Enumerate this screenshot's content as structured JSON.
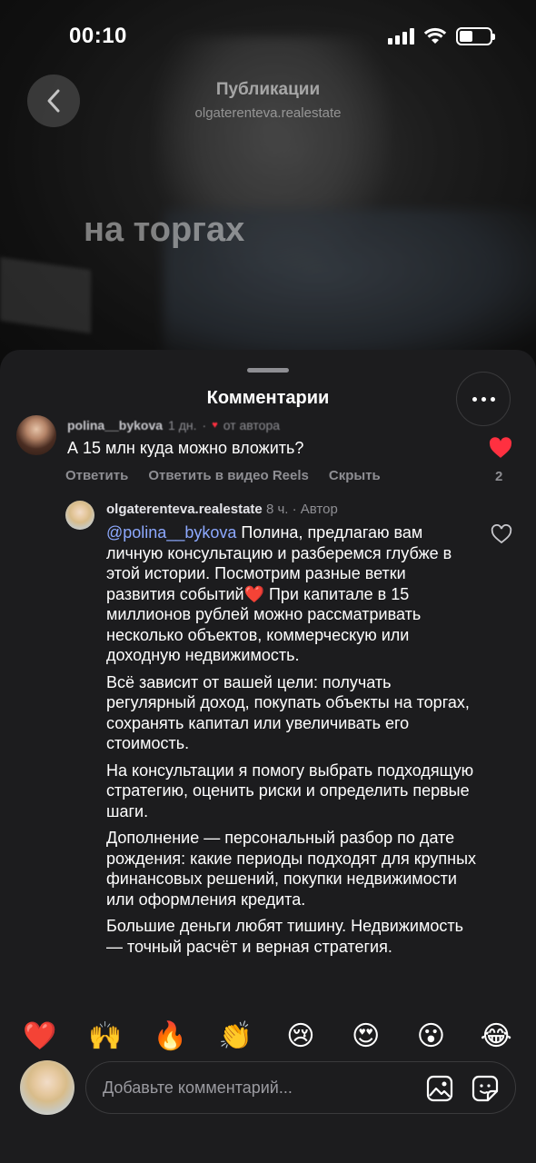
{
  "status_bar": {
    "time": "00:10"
  },
  "header": {
    "title": "Публикации",
    "subtitle": "olgaterenteva.realestate"
  },
  "video_overlay_text": "на торгах",
  "sheet": {
    "title": "Комментарии"
  },
  "comment1": {
    "username": "polina__bykova",
    "age": "1 дн.",
    "liked_by_author": "от автора",
    "text": "А 15 млн куда можно вложить?",
    "reply_label": "Ответить",
    "reply_video_label": "Ответить в видео Reels",
    "hide_label": "Скрыть",
    "likes": "2"
  },
  "comment2": {
    "username": "olgaterenteva.realestate",
    "meta": "8 ч. · Автор",
    "mention": "@polina__bykova",
    "p1": " Полина, предлагаю вам личную консультацию и разберемся глубже в этой истории. Посмотрим разные ветки развития событий",
    "p1_emoji": "❤️",
    "p1_tail": " При капитале в 15 миллионов рублей можно рассматривать несколько объектов, коммерческую или доходную недвижимость.",
    "p2": "Всё зависит от вашей цели: получать регулярный доход, покупать объекты на торгах, сохранять капитал или увеличивать его стоимость.",
    "p3": "На консультации я помогу выбрать подходящую стратегию, оценить риски и определить первые шаги.",
    "p4": "Дополнение — персональный разбор по дате рождения: какие периоды подходят для крупных финансовых решений, покупки недвижимости или оформления кредита.",
    "p5": "Большие деньги любят тишину. Недвижимость — точный расчёт и верная стратегия."
  },
  "emoji_reactions": [
    "❤️",
    "🙌",
    "🔥",
    "👏",
    "😢",
    "😍",
    "😮",
    "😂"
  ],
  "input": {
    "placeholder": "Добавьте комментарий..."
  },
  "colors": {
    "sheet_bg": "#1c1c1e",
    "like_red": "#ff3040",
    "mention": "#8da9ff",
    "secondary_text": "#8e8e93"
  }
}
